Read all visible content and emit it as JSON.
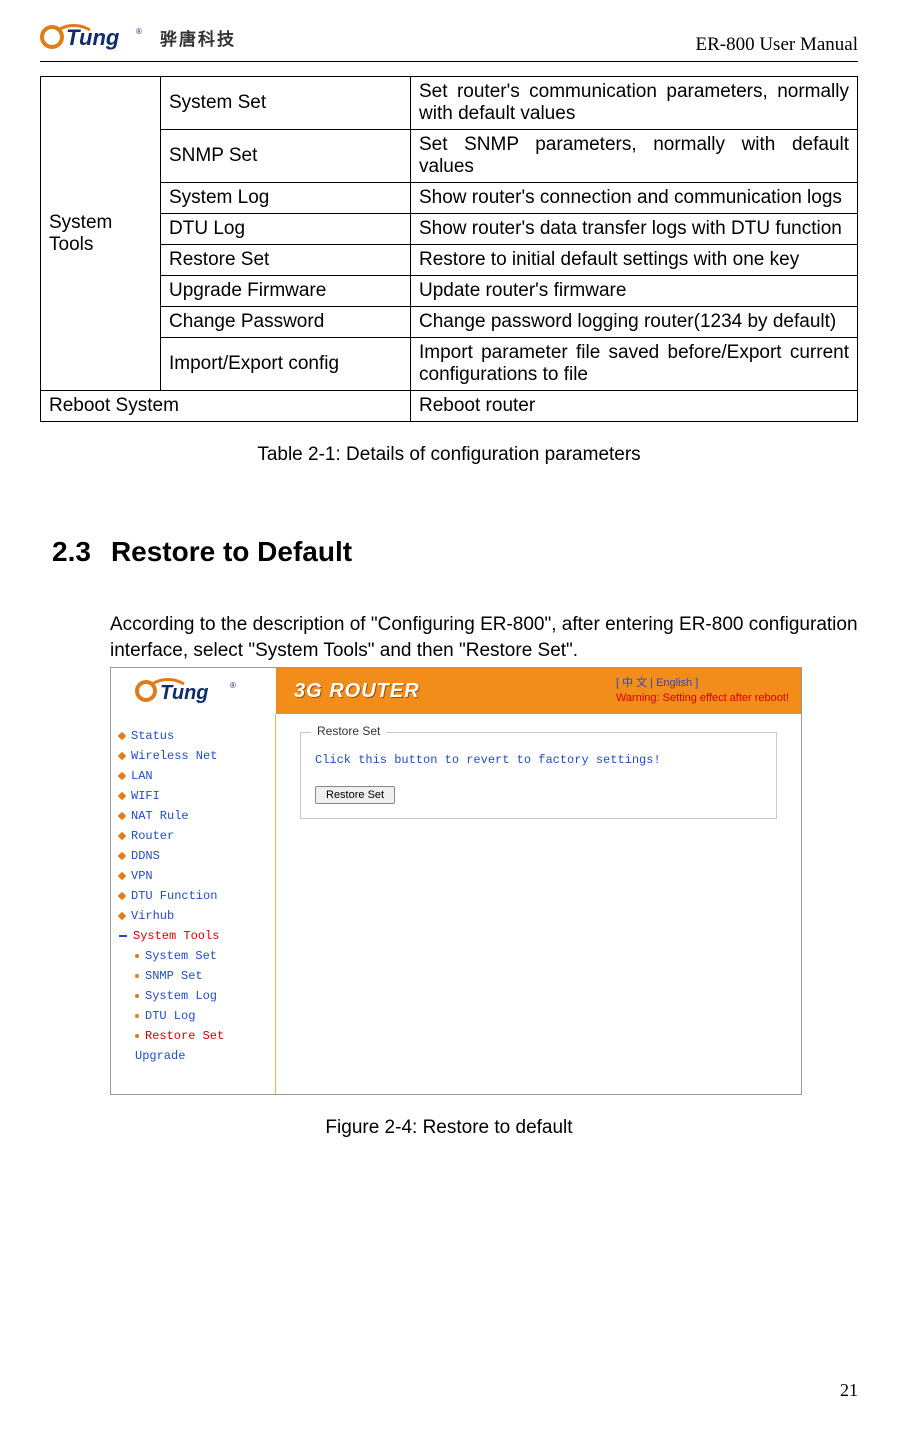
{
  "header": {
    "brand_cn": "骅唐科技",
    "doc_title": "ER-800 User Manual"
  },
  "table": {
    "group": "System Tools",
    "rows": [
      {
        "name": "System Set",
        "desc": "Set router's communication parameters, normally with default values"
      },
      {
        "name": "SNMP Set",
        "desc": "Set SNMP parameters, normally with default values"
      },
      {
        "name": "System Log",
        "desc": "Show router's connection and communication logs"
      },
      {
        "name": "DTU Log",
        "desc": "Show router's data transfer logs with DTU function"
      },
      {
        "name": "Restore Set",
        "desc": "Restore to initial default settings with one key"
      },
      {
        "name": "Upgrade Firmware",
        "desc": "Update router's firmware"
      },
      {
        "name": "Change Password",
        "desc": "Change password logging router(1234 by default)"
      },
      {
        "name": "Import/Export config",
        "desc": "Import parameter file saved before/Export current configurations to file"
      }
    ],
    "reboot": {
      "name": "Reboot System",
      "desc": "Reboot router"
    },
    "caption": "Table 2-1: Details of configuration parameters"
  },
  "section": {
    "number": "2.3",
    "title": "Restore to Default",
    "paragraph": "According to the description of \"Configuring ER-800\", after entering ER-800 configuration interface, select \"System Tools\" and then \"Restore Set\"."
  },
  "screenshot": {
    "banner_title": "3G  ROUTER",
    "lang": "[ 中 文  | English ]",
    "warning": "Warning: Setting effect after reboot!",
    "menu": [
      {
        "label": "Status",
        "active": false
      },
      {
        "label": "Wireless Net",
        "active": false
      },
      {
        "label": "LAN",
        "active": false
      },
      {
        "label": "WIFI",
        "active": false
      },
      {
        "label": "NAT Rule",
        "active": false
      },
      {
        "label": "Router",
        "active": false
      },
      {
        "label": "DDNS",
        "active": false
      },
      {
        "label": "VPN",
        "active": false
      },
      {
        "label": "DTU Function",
        "active": false
      },
      {
        "label": "Virhub",
        "active": false
      },
      {
        "label": "System Tools",
        "active": true
      }
    ],
    "submenu": [
      {
        "label": "System Set",
        "active": false
      },
      {
        "label": "SNMP Set",
        "active": false
      },
      {
        "label": "System Log",
        "active": false
      },
      {
        "label": "DTU Log",
        "active": false
      },
      {
        "label": "Restore Set",
        "active": true
      },
      {
        "label": "Upgrade",
        "active": false
      }
    ],
    "panel_legend": "Restore Set",
    "panel_msg": "Click this button to revert to factory settings!",
    "button": "Restore Set"
  },
  "figure_caption": "Figure 2-4: Restore to default",
  "page_number": "21"
}
